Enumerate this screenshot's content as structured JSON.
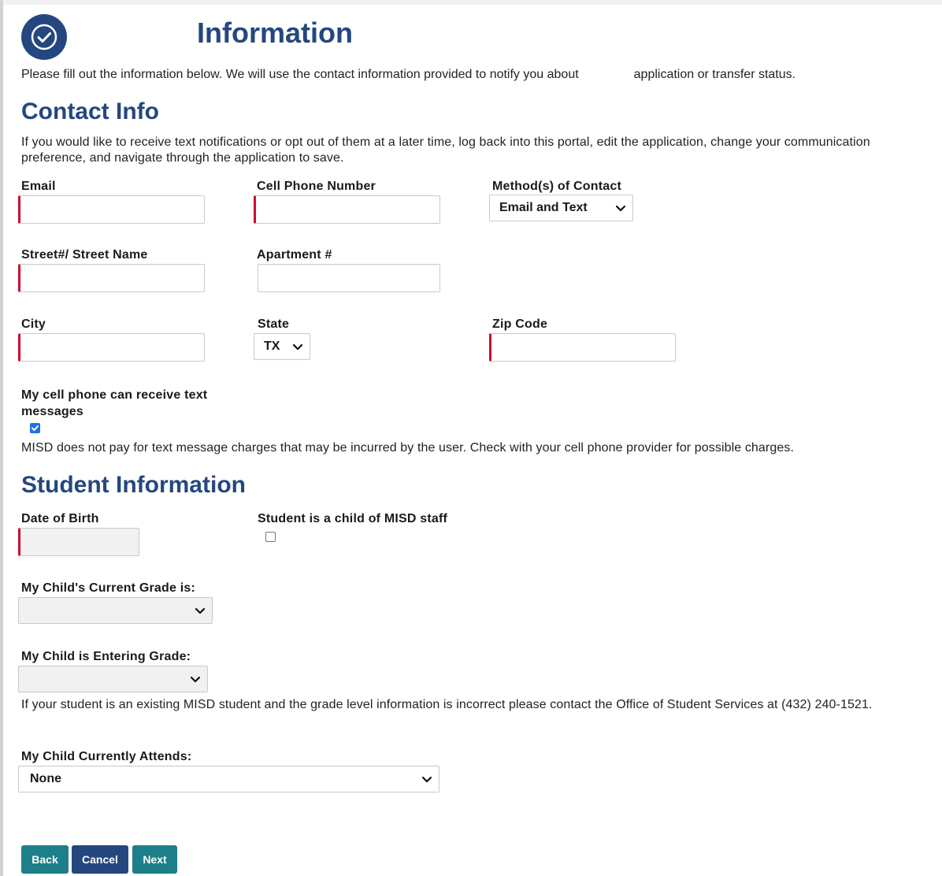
{
  "header": {
    "title": "Information",
    "intro_text_a": "Please fill out the information below. We will use the contact information provided to notify you about",
    "intro_text_b": "application or transfer status."
  },
  "contact": {
    "heading": "Contact Info",
    "text_notice": "If you would like to receive text notifications or opt out of them at a later time, log back into this portal, edit the application, change your communication preference, and navigate through the application to save.",
    "email_label": "Email",
    "email_value": "",
    "cell_label": "Cell Phone Number",
    "cell_value": "",
    "method_label": "Method(s) of Contact",
    "method_value": "Email and Text",
    "street_label": "Street#/ Street Name",
    "street_value": "",
    "apartment_label": "Apartment #",
    "apartment_value": "",
    "city_label": "City",
    "city_value": "",
    "state_label": "State",
    "state_value": "TX",
    "zip_label": "Zip Code",
    "zip_value": "",
    "sms_label": "My cell phone can receive text messages",
    "sms_checked": true,
    "sms_disclaimer": "MISD does not pay for text message charges that may be incurred by the user. Check with your cell phone provider for possible charges."
  },
  "student": {
    "heading": "Student Information",
    "dob_label": "Date of Birth",
    "dob_value": "",
    "staff_child_label": "Student is a child of MISD staff",
    "staff_child_checked": false,
    "current_grade_label": "My Child's Current Grade is:",
    "current_grade_value": "",
    "entering_grade_label": "My Child is Entering Grade:",
    "entering_grade_value": "",
    "grade_notice": "If your student is an existing MISD student and the grade level information is incorrect please contact the Office of Student Services at (432) 240-1521.",
    "attends_label": "My Child Currently Attends:",
    "attends_value": "None"
  },
  "buttons": {
    "back": "Back",
    "cancel": "Cancel",
    "next": "Next"
  },
  "icons": {
    "logo": "check-badge-icon",
    "select_arrow": "chevron-down-icon"
  },
  "colors": {
    "brand_blue": "#24477f",
    "teal": "#1d7f89",
    "required_marker": "#c8102e",
    "checkbox_blue": "#1a73e8"
  }
}
